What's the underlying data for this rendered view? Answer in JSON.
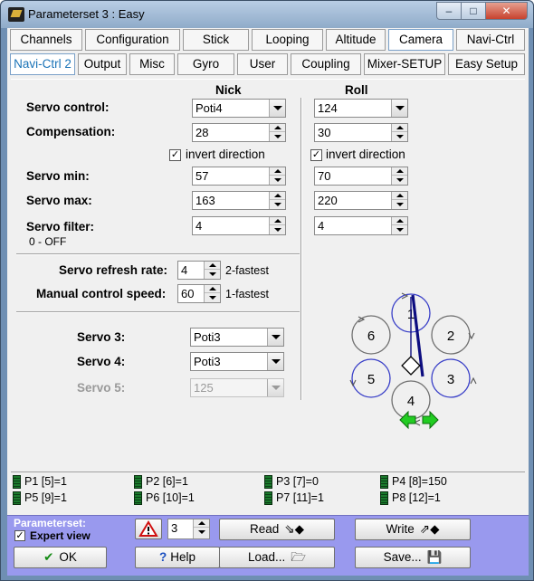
{
  "window": {
    "title": "Parameterset 3 : Easy",
    "min": "–",
    "max": "□",
    "close": "✕"
  },
  "tabs_row1": [
    "Channels",
    "Configuration",
    "Stick",
    "Looping",
    "Altitude",
    "Camera",
    "Navi-Ctrl"
  ],
  "tabs_row2": [
    "Navi-Ctrl 2",
    "Output",
    "Misc",
    "Gyro",
    "User",
    "Coupling",
    "Mixer-SETUP",
    "Easy Setup"
  ],
  "columns": {
    "nick": "Nick",
    "roll": "Roll"
  },
  "rows": {
    "servo_control": {
      "label": "Servo control:",
      "nick": "Poti4",
      "roll": "124"
    },
    "compensation": {
      "label": "Compensation:",
      "nick": "28",
      "roll": "30"
    },
    "invert": {
      "label": "invert direction",
      "nick_checked": true,
      "roll_checked": true
    },
    "servo_min": {
      "label": "Servo min:",
      "nick": "57",
      "roll": "70"
    },
    "servo_max": {
      "label": "Servo max:",
      "nick": "163",
      "roll": "220"
    },
    "servo_filter": {
      "label": "Servo filter:",
      "sublabel": "0 - OFF",
      "nick": "4",
      "roll": "4"
    }
  },
  "refresh": {
    "label": "Servo refresh rate:",
    "value": "4",
    "hint": "2-fastest"
  },
  "manual": {
    "label": "Manual control speed:",
    "value": "60",
    "hint": "1-fastest"
  },
  "servo3": {
    "label": "Servo 3:",
    "value": "Poti3"
  },
  "servo4": {
    "label": "Servo 4:",
    "value": "Poti3"
  },
  "servo5": {
    "label": "Servo 5:",
    "value": "125"
  },
  "rotors": [
    "1",
    "2",
    "3",
    "4",
    "5",
    "6"
  ],
  "poti": [
    "P1 [5]=1",
    "P2 [6]=1",
    "P3 [7]=0",
    "P4 [8]=150",
    "P5 [9]=1",
    "P6 [10]=1",
    "P7 [11]=1",
    "P8 [12]=1"
  ],
  "bottom": {
    "parameterset_label": "Parameterset:",
    "expert_view": "Expert view",
    "set_value": "3",
    "read": "Read",
    "write": "Write",
    "ok": "OK",
    "help": "Help",
    "load": "Load...",
    "save": "Save..."
  },
  "colors": {
    "bottom_bar": "#9999ee",
    "rotor_blue": "#3a40c8",
    "arrow_green": "#22cc22"
  }
}
